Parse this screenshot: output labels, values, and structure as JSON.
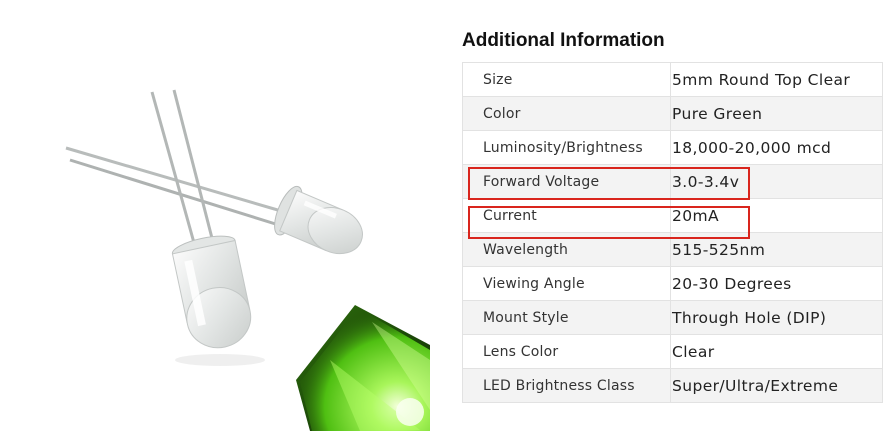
{
  "section": {
    "title": "Additional Information"
  },
  "specs": [
    {
      "label": "Size",
      "value": "5mm Round Top Clear"
    },
    {
      "label": "Color",
      "value": "Pure Green"
    },
    {
      "label": "Luminosity/Brightness",
      "value": "18,000-20,000 mcd"
    },
    {
      "label": "Forward Voltage",
      "value": "3.0-3.4v",
      "highlighted": true
    },
    {
      "label": "Current",
      "value": "20mA",
      "highlighted": true
    },
    {
      "label": "Wavelength",
      "value": "515-525nm"
    },
    {
      "label": "Viewing Angle",
      "value": "20-30 Degrees"
    },
    {
      "label": "Mount Style",
      "value": "Through Hole (DIP)"
    },
    {
      "label": "Lens Color",
      "value": "Clear"
    },
    {
      "label": "LED Brightness Class",
      "value": "Super/Ultra/Extreme"
    }
  ],
  "colors": {
    "highlight_border": "#d9251d",
    "stripe": "#f3f3f3",
    "glow": "#7ae63c"
  }
}
